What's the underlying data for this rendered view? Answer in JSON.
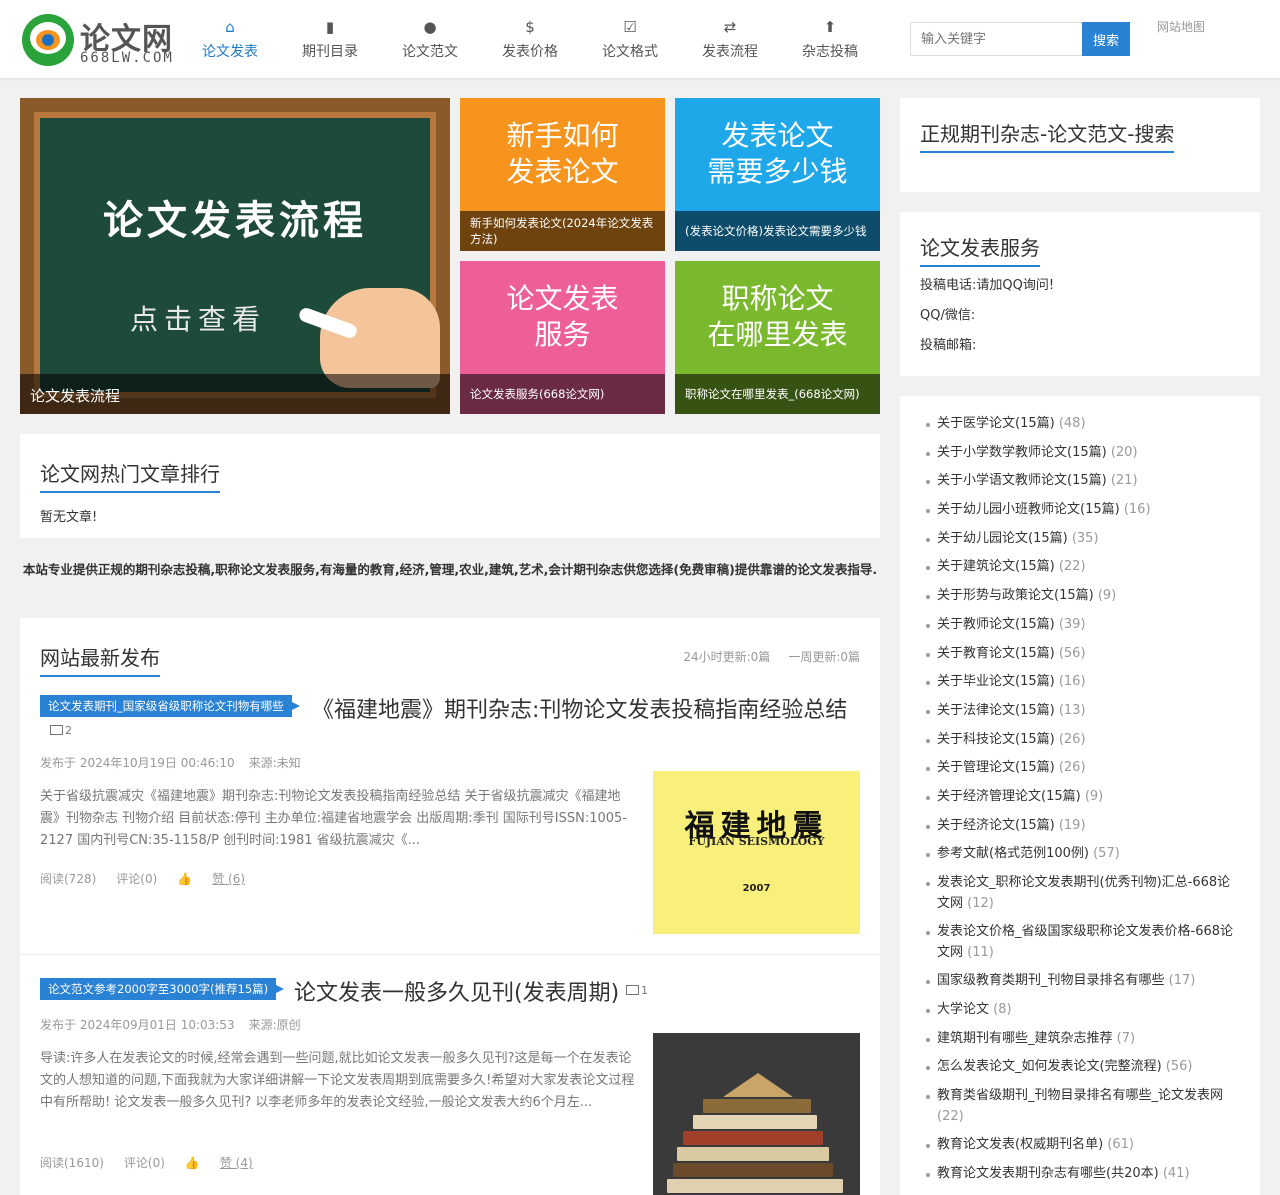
{
  "header": {
    "logo_name": "论文网",
    "logo_domain": "668LW.COM",
    "nav": [
      {
        "label": "论文发表",
        "icon": "⌂",
        "icon_name": "home-icon",
        "active": true
      },
      {
        "label": "期刊目录",
        "icon": "▮",
        "icon_name": "book-icon"
      },
      {
        "label": "论文范文",
        "icon": "●",
        "icon_name": "tree-icon"
      },
      {
        "label": "发表价格",
        "icon": "$",
        "icon_name": "dollar-icon"
      },
      {
        "label": "论文格式",
        "icon": "☑",
        "icon_name": "check-icon"
      },
      {
        "label": "发表流程",
        "icon": "⇄",
        "icon_name": "retweet-icon"
      },
      {
        "label": "杂志投稿",
        "icon": "⬆",
        "icon_name": "upload-icon"
      }
    ],
    "search_placeholder": "输入关键字",
    "search_button": "搜索",
    "sitemap": "网站地图"
  },
  "hero": {
    "board_title": "论文发表流程",
    "board_sub": "点击查看",
    "caption": "论文发表流程"
  },
  "tiles": [
    {
      "text": "新手如何\n发表论文",
      "caption": "新手如何发表论文(2024年论文发表方法)",
      "color": "#f7941d"
    },
    {
      "text": "发表论文\n需要多少钱",
      "caption": "(发表论文价格)发表论文需要多少钱",
      "color": "#1ea8ea"
    },
    {
      "text": "论文发表\n服务",
      "caption": "论文发表服务(668论文网)",
      "color": "#ee5f9a"
    },
    {
      "text": "职称论文\n在哪里发表",
      "caption": "职称论文在哪里发表_(668论文网)",
      "color": "#7ab92e"
    }
  ],
  "hot": {
    "title": "论文网热门文章排行",
    "empty": "暂无文章!"
  },
  "intro": "本站专业提供正规的期刊杂志投稿,职称论文发表服务,有海量的教育,经济,管理,农业,建筑,艺术,会计期刊杂志供您选择(免费审稿)提供靠谱的论文发表指导.",
  "latest": {
    "title": "网站最新发布",
    "stats_24h": "24小时更新:0篇",
    "stats_week": "一周更新:0篇",
    "articles": [
      {
        "category": "论文发表期刊_国家级省级职称论文刊物有哪些",
        "title": "《福建地震》期刊杂志:刊物论文发表投稿指南经验总结",
        "img_count": "2",
        "date": "发布于 2024年10月19日 00:46:10",
        "source": "来源:未知",
        "excerpt": "关于省级抗震减灾《福建地震》期刊杂志:刊物论文发表投稿指南经验总结 关于省级抗震减灾《福建地震》刊物杂志 刊物介绍 目前状态:停刊 主办单位:福建省地震学会 出版周期:季刊 国际刊号ISSN:1005-2127 国内刊号CN:35-1158/P 创刊时间:1981 省级抗震减灾《...",
        "reads": "阅读(728)",
        "comments": "评论(0)",
        "likes": "赞 (6)",
        "thumb_title": "福建地震",
        "thumb_sub": "FUJIAN SEISMOLOGY",
        "thumb_year": "2007"
      },
      {
        "category": "论文范文参考2000字至3000字(推荐15篇)",
        "title": "论文发表一般多久见刊(发表周期)",
        "img_count": "1",
        "date": "发布于 2024年09月01日 10:03:53",
        "source": "来源:原创",
        "excerpt": "导读:许多人在发表论文的时候,经常会遇到一些问题,就比如论文发表一般多久见刊?这是每一个在发表论文的人想知道的问题,下面我就为大家详细讲解一下论文发表周期到底需要多久!希望对大家发表论文过程中有所帮助! 论文发表一般多久见刊? 以李老师多年的发表论文经验,一般论文发表大约6个月左...",
        "reads": "阅读(1610)",
        "comments": "评论(0)",
        "likes": "赞 (4)"
      }
    ]
  },
  "sidebar": {
    "search_title": "正规期刊杂志-论文范文-搜索",
    "service_title": "论文发表服务",
    "phone": "投稿电话:请加QQ询问!",
    "qq": "QQ/微信:",
    "email": "投稿邮箱:",
    "categories": [
      {
        "name": "关于医学论文(15篇)",
        "count": "(48)"
      },
      {
        "name": "关于小学数学教师论文(15篇)",
        "count": "(20)"
      },
      {
        "name": "关于小学语文教师论文(15篇)",
        "count": "(21)"
      },
      {
        "name": "关于幼儿园小班教师论文(15篇)",
        "count": "(16)"
      },
      {
        "name": "关于幼儿园论文(15篇)",
        "count": "(35)"
      },
      {
        "name": "关于建筑论文(15篇)",
        "count": "(22)"
      },
      {
        "name": "关于形势与政策论文(15篇)",
        "count": "(9)"
      },
      {
        "name": "关于教师论文(15篇)",
        "count": "(39)"
      },
      {
        "name": "关于教育论文(15篇)",
        "count": "(56)"
      },
      {
        "name": "关于毕业论文(15篇)",
        "count": "(16)"
      },
      {
        "name": "关于法律论文(15篇)",
        "count": "(13)"
      },
      {
        "name": "关于科技论文(15篇)",
        "count": "(26)"
      },
      {
        "name": "关于管理论文(15篇)",
        "count": "(26)"
      },
      {
        "name": "关于经济管理论文(15篇)",
        "count": "(9)"
      },
      {
        "name": "关于经济论文(15篇)",
        "count": "(19)"
      },
      {
        "name": "参考文献(格式范例100例)",
        "count": "(57)"
      },
      {
        "name": "发表论文_职称论文发表期刊(优秀刊物)汇总-668论文网",
        "count": "(12)"
      },
      {
        "name": "发表论文价格_省级国家级职称论文发表价格-668论文网",
        "count": "(11)"
      },
      {
        "name": "国家级教育类期刊_刊物目录排名有哪些",
        "count": "(17)"
      },
      {
        "name": "大学论文",
        "count": "(8)"
      },
      {
        "name": "建筑期刊有哪些_建筑杂志推荐",
        "count": "(7)"
      },
      {
        "name": "怎么发表论文_如何发表论文(完整流程)",
        "count": "(56)"
      },
      {
        "name": "教育类省级期刊_刊物目录排名有哪些_论文发表网",
        "count": "(22)"
      },
      {
        "name": "教育论文发表(权威期刊名单)",
        "count": "(61)"
      },
      {
        "name": "教育论文发表期刊杂志有哪些(共20本)",
        "count": "(41)"
      }
    ]
  }
}
